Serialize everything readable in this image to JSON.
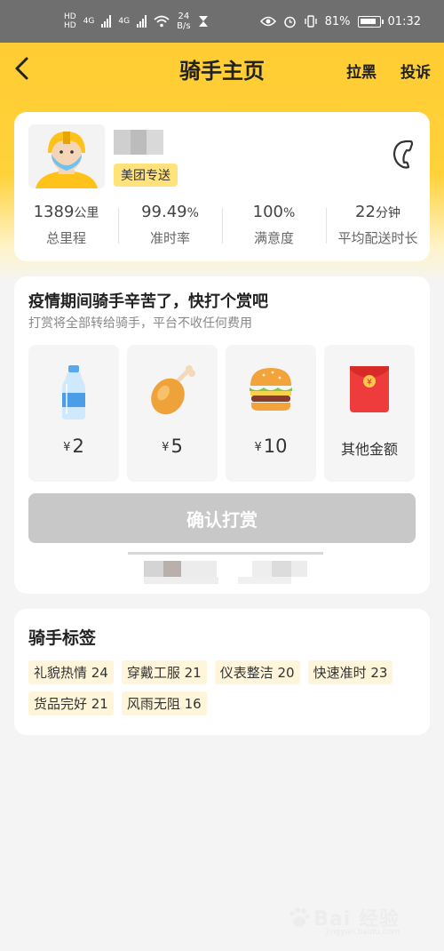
{
  "status_bar": {
    "hd1": "HD",
    "hd2": "HD",
    "net1": "4G",
    "net2": "4G",
    "speed_value": "24",
    "speed_unit": "B/s",
    "battery": "81%",
    "time": "01:32"
  },
  "nav": {
    "title": "骑手主页",
    "block_label": "拉黑",
    "complain_label": "投诉"
  },
  "rider": {
    "badge": "美团专送",
    "stats": [
      {
        "value": "1389",
        "unit": "公里",
        "label": "总里程"
      },
      {
        "value": "99.49",
        "unit": "%",
        "label": "准时率"
      },
      {
        "value": "100",
        "unit": "%",
        "label": "满意度"
      },
      {
        "value": "22",
        "unit": "分钟",
        "label": "平均配送时长"
      }
    ]
  },
  "tip": {
    "title": "疫情期间骑手辛苦了，快打个赏吧",
    "subtitle": "打赏将全部转给骑手，平台不收任何费用",
    "currency": "¥",
    "options": [
      {
        "icon": "water-bottle-icon",
        "amount": "2"
      },
      {
        "icon": "chicken-leg-icon",
        "amount": "5"
      },
      {
        "icon": "burger-icon",
        "amount": "10"
      },
      {
        "icon": "red-envelope-icon",
        "label": "其他金额"
      }
    ],
    "envelope_mark": "¥",
    "confirm_label": "确认打赏"
  },
  "tags": {
    "title": "骑手标签",
    "items": [
      "礼貌热情 24",
      "穿戴工服 21",
      "仪表整洁 20",
      "快速准时 23",
      "货品完好 21",
      "风雨无阻 16"
    ]
  },
  "watermark": {
    "text": "Bai 经验",
    "sub": "jingyan.baidu.com"
  },
  "colors": {
    "brand_yellow": "#ffcc33",
    "badge_bg": "#ffe27a",
    "button_disabled": "#c8c8c8",
    "tag_bg": "#fff5da"
  }
}
